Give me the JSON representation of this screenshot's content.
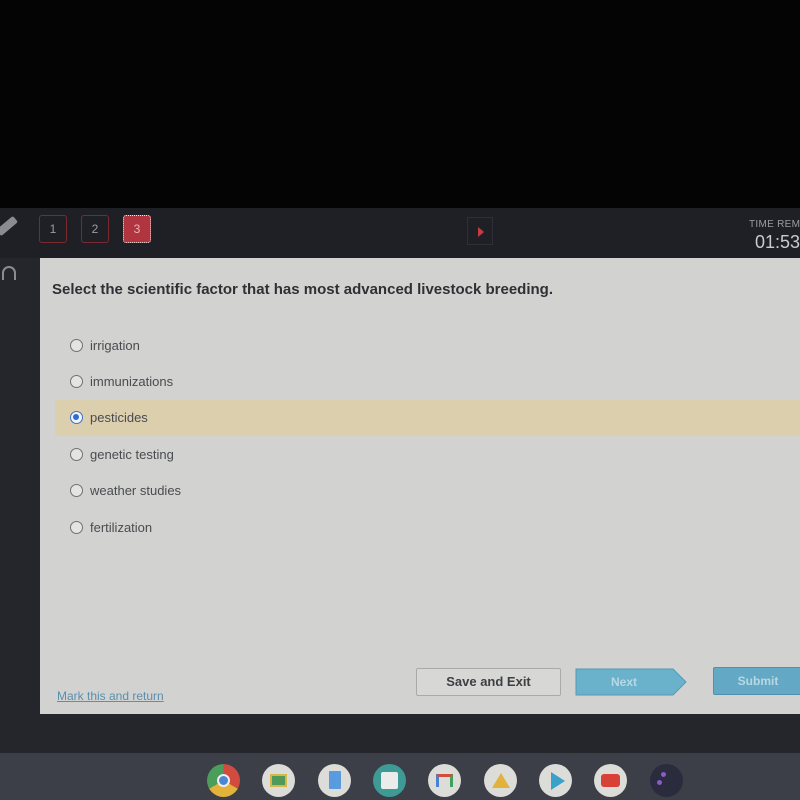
{
  "topbar": {
    "question_numbers": [
      "1",
      "2",
      "3"
    ],
    "active_question": "3",
    "timer_label": "TIME REMAINING",
    "timer_label_visible": "TIME REM",
    "timer_value": "01:53"
  },
  "question": {
    "text": "Select the scientific factor that has most advanced livestock breeding.",
    "options": [
      {
        "label": "irrigation",
        "selected": false
      },
      {
        "label": "immunizations",
        "selected": false
      },
      {
        "label": "pesticides",
        "selected": true
      },
      {
        "label": "genetic testing",
        "selected": false
      },
      {
        "label": "weather studies",
        "selected": false
      },
      {
        "label": "fertilization",
        "selected": false
      }
    ]
  },
  "footer": {
    "mark_link": "Mark this and return",
    "save_exit_label": "Save and Exit",
    "next_label": "Next",
    "submit_label": "Submit"
  },
  "shelf": {
    "apps": [
      "chrome-icon",
      "google-classroom-icon",
      "google-docs-icon",
      "calculator-icon",
      "gmail-icon",
      "google-drive-icon",
      "play-store-icon",
      "youtube-icon",
      "game-icon"
    ]
  },
  "colors": {
    "accent_red": "#b0353f",
    "selected_row": "#dccfae",
    "radio_selected": "#2f6bd1",
    "button_blue": "#63a8c4",
    "link": "#5a8fb0"
  }
}
